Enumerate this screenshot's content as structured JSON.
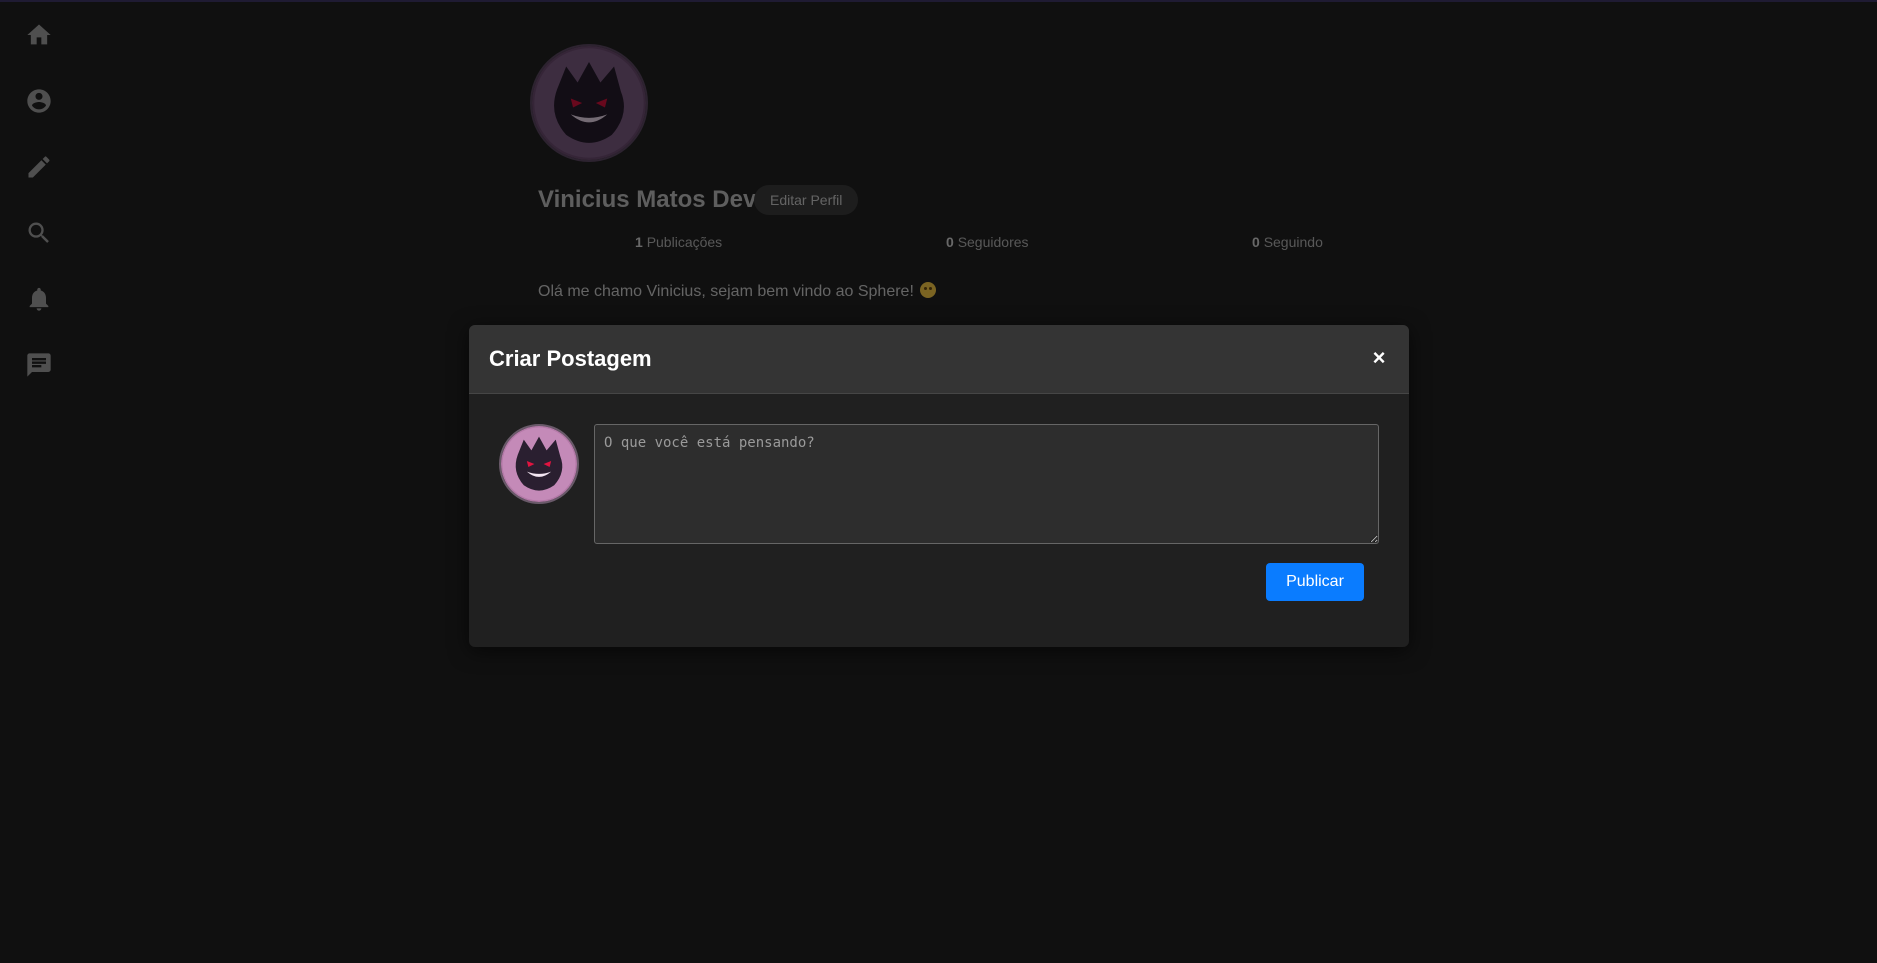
{
  "sidebar": {
    "items": [
      {
        "icon": "home-icon",
        "label": "home"
      },
      {
        "icon": "account-icon",
        "label": "profile"
      },
      {
        "icon": "pencil-icon",
        "label": "create"
      },
      {
        "icon": "search-icon",
        "label": "search"
      },
      {
        "icon": "bell-icon",
        "label": "notifications"
      },
      {
        "icon": "chat-icon",
        "label": "messages"
      }
    ]
  },
  "profile": {
    "name": "Vinicius Matos Dev",
    "edit_label": "Editar Perfil",
    "stats": [
      {
        "count": "1",
        "label": "Publicações"
      },
      {
        "count": "0",
        "label": "Seguidores"
      },
      {
        "count": "0",
        "label": "Seguindo"
      }
    ],
    "bio": "Olá me chamo Vinicius, sejam bem vindo ao Sphere!"
  },
  "modal": {
    "title": "Criar Postagem",
    "close_label": "×",
    "placeholder": "O que você está pensando?",
    "publish_label": "Publicar"
  },
  "colors": {
    "background": "#212121",
    "accent": "#0a7cff",
    "modal_header": "#343434"
  }
}
